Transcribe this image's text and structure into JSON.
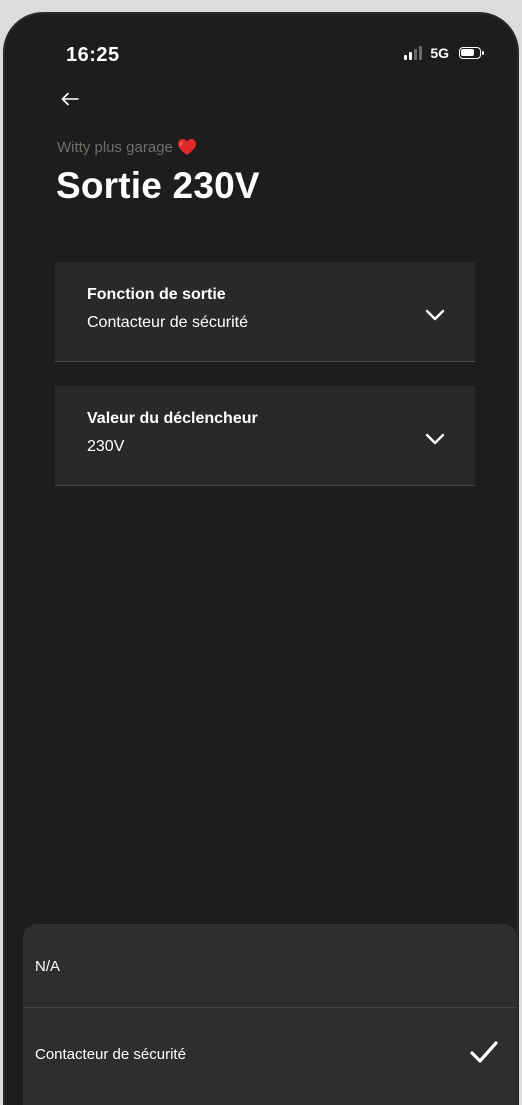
{
  "status_bar": {
    "time": "16:25",
    "network": "5G"
  },
  "header": {
    "subtitle": "Witty plus garage",
    "title": "Sortie 230V"
  },
  "settings": [
    {
      "label": "Fonction de sortie",
      "value": "Contacteur de sécurité"
    },
    {
      "label": "Valeur du déclencheur",
      "value": "230V"
    }
  ],
  "sheet": {
    "options": [
      {
        "label": "N/A",
        "selected": false
      },
      {
        "label": "Contacteur de sécurité",
        "selected": true
      }
    ]
  },
  "icons": {
    "back": "arrow-left-icon",
    "heart": "heart-icon",
    "chevron": "chevron-down-icon",
    "check": "check-icon"
  },
  "colors": {
    "background": "#1e1d1c",
    "card": "#2a2928",
    "sheet": "#2f2e2d",
    "heart": "#e02a2a",
    "subtitle": "#6f6d6a"
  }
}
